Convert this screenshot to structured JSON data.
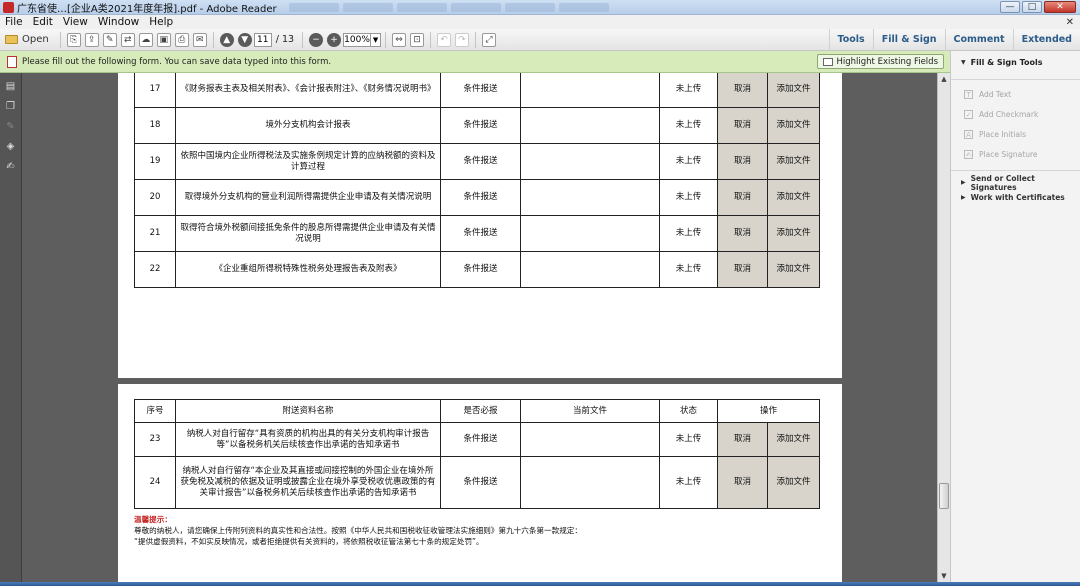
{
  "window": {
    "title": "广东省使…[企业A类2021年度年报].pdf - Adobe Reader",
    "controls": [
      "—",
      "□",
      "✕"
    ]
  },
  "menu": [
    "File",
    "Edit",
    "View",
    "Window",
    "Help"
  ],
  "toolbar": {
    "open_label": "Open",
    "page_current": "11",
    "page_total": "/ 13",
    "zoom": "100%",
    "right_links": [
      "Tools",
      "Fill & Sign",
      "Comment",
      "Extended"
    ]
  },
  "formbar": {
    "message": "Please fill out the following form. You can save data typed into this form.",
    "highlight_label": "Highlight Existing Fields"
  },
  "rightpane": {
    "title": "Fill & Sign Tools",
    "tools": [
      {
        "label": "Add Text",
        "icon": "T"
      },
      {
        "label": "Add Checkmark",
        "icon": "✓"
      },
      {
        "label": "Place Initials",
        "icon": "A"
      },
      {
        "label": "Place Signature",
        "icon": "✍"
      }
    ],
    "sections": [
      "Send or Collect Signatures",
      "Work with Certificates"
    ]
  },
  "table": {
    "headers": {
      "no": "序号",
      "name": "附送资料名称",
      "required": "是否必报",
      "file": "当前文件",
      "status": "状态",
      "ops": "操作"
    },
    "page1_rows": [
      {
        "no": "17",
        "name": "《财务报表主表及相关附表》、《会计报表附注》、《财务情况说明书》",
        "required": "条件报送",
        "status": "未上传",
        "cancel": "取消",
        "add": "添加文件"
      },
      {
        "no": "18",
        "name": "境外分支机构会计报表",
        "required": "条件报送",
        "status": "未上传",
        "cancel": "取消",
        "add": "添加文件"
      },
      {
        "no": "19",
        "name": "依照中国境内企业所得税法及实施条例规定计算的应纳税额的资料及计算过程",
        "required": "条件报送",
        "status": "未上传",
        "cancel": "取消",
        "add": "添加文件"
      },
      {
        "no": "20",
        "name": "取得境外分支机构的营业利润所得需提供企业申请及有关情况说明",
        "required": "条件报送",
        "status": "未上传",
        "cancel": "取消",
        "add": "添加文件"
      },
      {
        "no": "21",
        "name": "取得符合境外税额间接抵免条件的股息所得需提供企业申请及有关情况说明",
        "required": "条件报送",
        "status": "未上传",
        "cancel": "取消",
        "add": "添加文件"
      },
      {
        "no": "22",
        "name": "《企业重组所得税特殊性税务处理报告表及附表》",
        "required": "条件报送",
        "status": "未上传",
        "cancel": "取消",
        "add": "添加文件"
      }
    ],
    "page2_rows": [
      {
        "no": "23",
        "name": "纳税人对自行留存“具有资质的机构出具的有关分支机构审计报告等”以备税务机关后续核查作出承诺的告知承诺书",
        "required": "条件报送",
        "status": "未上传",
        "cancel": "取消",
        "add": "添加文件"
      },
      {
        "no": "24",
        "name": "纳税人对自行留存“本企业及其直接或间接控制的外国企业在境外所获免税及减税的依据及证明或披露企业在境外享受税收优惠政策的有关审计报告”以备税务机关后续核查作出承诺的告知承诺书",
        "required": "条件报送",
        "status": "未上传",
        "cancel": "取消",
        "add": "添加文件"
      }
    ]
  },
  "tips": {
    "title": "温馨提示：",
    "line1": "尊敬的纳税人，请您确保上传附列资料的真实性和合法性。按照《中华人民共和国税收征收管理法实施细则》第九十六条第一款规定：",
    "line2": "“提供虚假资料，不如实反映情况，或者拒绝提供有关资料的，将依照税收征管法第七十条的规定处罚”。"
  }
}
